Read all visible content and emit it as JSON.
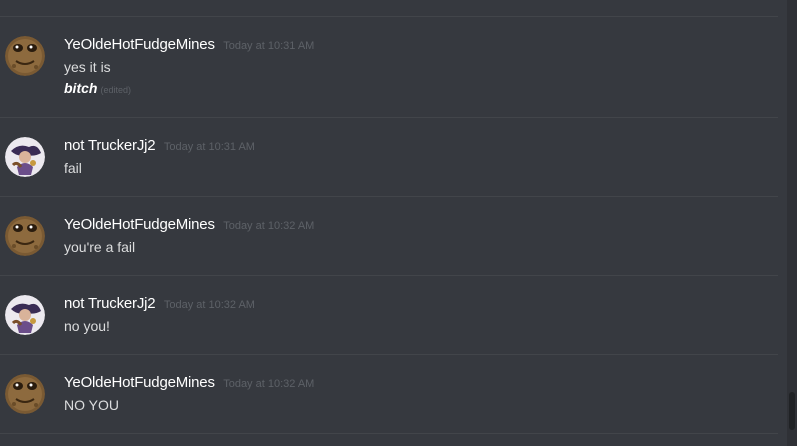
{
  "messages": [
    {
      "author": "YeOldeHotFudgeMines",
      "avatar": "brown-face-avatar",
      "timestamp": "Today at 10:31 AM",
      "lines": [
        "yes it is"
      ],
      "extra_line": "bitch",
      "edited_label": "(edited)"
    },
    {
      "author": "not TruckerJj2",
      "avatar": "character-avatar",
      "timestamp": "Today at 10:31 AM",
      "lines": [
        "fail"
      ]
    },
    {
      "author": "YeOldeHotFudgeMines",
      "avatar": "brown-face-avatar",
      "timestamp": "Today at 10:32 AM",
      "lines": [
        "you're a fail"
      ]
    },
    {
      "author": "not TruckerJj2",
      "avatar": "character-avatar",
      "timestamp": "Today at 10:32 AM",
      "lines": [
        "no you!"
      ]
    },
    {
      "author": "YeOldeHotFudgeMines",
      "avatar": "brown-face-avatar",
      "timestamp": "Today at 10:32 AM",
      "lines": [
        "NO YOU"
      ]
    }
  ],
  "colors": {
    "background": "#36393f",
    "username": "#ffffff",
    "message_text": "#dcddde",
    "timestamp": "#5d6167",
    "divider": "#42454a"
  }
}
